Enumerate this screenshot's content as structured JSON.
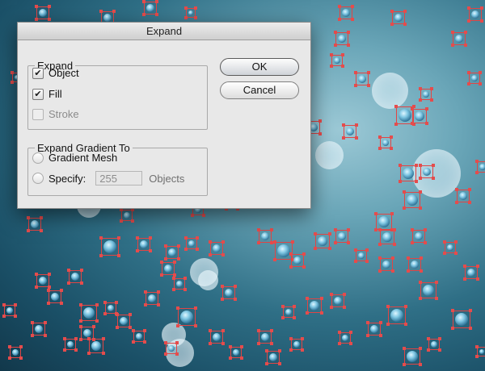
{
  "dialog": {
    "title": "Expand",
    "expand_group": {
      "legend": "Expand",
      "object": {
        "label": "Object",
        "checked": true
      },
      "fill": {
        "label": "Fill",
        "checked": true
      },
      "stroke": {
        "label": "Stroke",
        "checked": false,
        "disabled": true
      }
    },
    "gradient_group": {
      "legend": "Expand Gradient To",
      "gradient_mesh_label": "Gradient Mesh",
      "specify_label": "Specify:",
      "specify_value": "255",
      "objects_label": "Objects"
    },
    "ok_label": "OK",
    "cancel_label": "Cancel"
  },
  "colors": {
    "selection_handles": "#e54c4c",
    "background_dark": "#12384b",
    "background_light": "#9cc9d6"
  }
}
